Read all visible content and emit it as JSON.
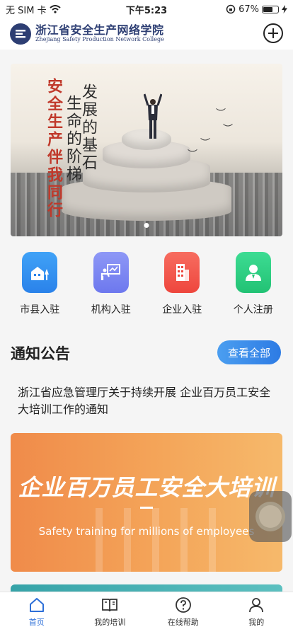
{
  "status_bar": {
    "carrier": "无 SIM 卡",
    "time": "下午5:23",
    "battery": "67%",
    "battery_level": 0.67
  },
  "header": {
    "logo_cn": "浙江省安全生产网络学院",
    "logo_en": "Zhejiang Safety Production Network College"
  },
  "banner": {
    "text_left": "安全生产伴我同行",
    "text_right_a": "发展的基石",
    "text_right_b": "生命的阶梯"
  },
  "quick_entries": [
    {
      "label": "市县入驻",
      "color": "#2f8df0",
      "icon": "building-tree-icon"
    },
    {
      "label": "机构入驻",
      "color": "#7b86f2",
      "icon": "teacher-board-icon"
    },
    {
      "label": "企业入驻",
      "color": "#f2584e",
      "icon": "office-tower-icon"
    },
    {
      "label": "个人注册",
      "color": "#2fcf84",
      "icon": "person-icon"
    }
  ],
  "notice": {
    "title": "通知公告",
    "view_all": "查看全部",
    "item": "浙江省应急管理厅关于持续开展 企业百万员工安全大培训工作的通知"
  },
  "promo": {
    "title": "企业百万员工安全大培训",
    "subtitle": "Safety training for millions of employees"
  },
  "tabbar": [
    {
      "label": "首页",
      "icon": "home-icon",
      "active": true
    },
    {
      "label": "我的培训",
      "icon": "book-icon",
      "active": false
    },
    {
      "label": "在线帮助",
      "icon": "help-icon",
      "active": false
    },
    {
      "label": "我的",
      "icon": "user-icon",
      "active": false
    }
  ],
  "colors": {
    "accent": "#2d6fd8",
    "brand": "#2d3e73"
  }
}
